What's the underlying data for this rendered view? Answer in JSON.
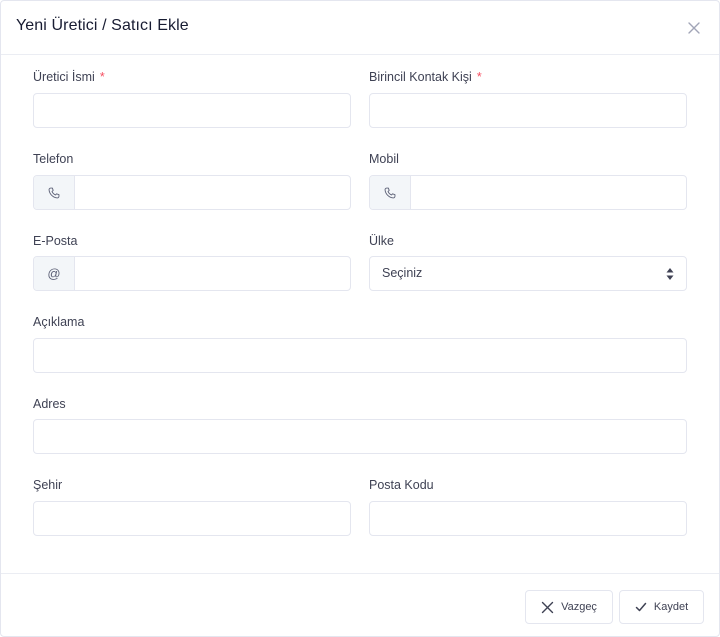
{
  "modal": {
    "title": "Yeni Üretici / Satıcı Ekle",
    "close_icon": "close-icon"
  },
  "form": {
    "manufacturer_name": {
      "label": "Üretici İsmi",
      "required_mark": "*",
      "value": ""
    },
    "primary_contact": {
      "label": "Birincil Kontak Kişi",
      "required_mark": "*",
      "value": ""
    },
    "phone": {
      "label": "Telefon",
      "icon": "phone-icon",
      "value": ""
    },
    "mobile": {
      "label": "Mobil",
      "icon": "phone-icon",
      "value": ""
    },
    "email": {
      "label": "E-Posta",
      "addon": "@",
      "value": ""
    },
    "country": {
      "label": "Ülke",
      "selected": "Seçiniz"
    },
    "description": {
      "label": "Açıklama",
      "value": ""
    },
    "address": {
      "label": "Adres",
      "value": ""
    },
    "city": {
      "label": "Şehir",
      "value": ""
    },
    "postal_code": {
      "label": "Posta Kodu",
      "value": ""
    }
  },
  "footer": {
    "cancel_label": "Vazgeç",
    "save_label": "Kaydet"
  },
  "colors": {
    "required": "#f64e60",
    "border": "#e4e6ef",
    "addon_bg": "#f3f6f9"
  }
}
